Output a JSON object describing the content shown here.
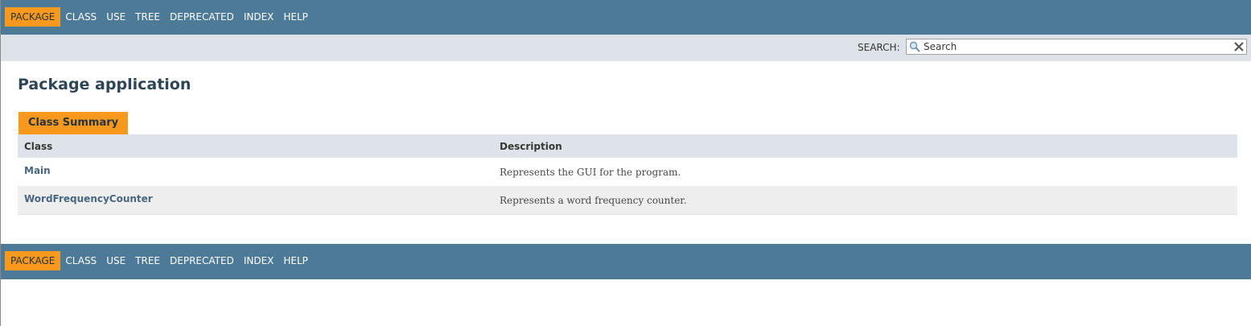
{
  "nav": {
    "items": [
      {
        "label": "PACKAGE",
        "active": true
      },
      {
        "label": "CLASS",
        "active": false
      },
      {
        "label": "USE",
        "active": false
      },
      {
        "label": "TREE",
        "active": false
      },
      {
        "label": "DEPRECATED",
        "active": false
      },
      {
        "label": "INDEX",
        "active": false
      },
      {
        "label": "HELP",
        "active": false
      }
    ]
  },
  "search": {
    "label": "SEARCH:",
    "placeholder": "Search",
    "value": ""
  },
  "page": {
    "title": "Package application"
  },
  "summary": {
    "caption": "Class Summary",
    "headers": {
      "class": "Class",
      "description": "Description"
    },
    "rows": [
      {
        "name": "Main",
        "description": "Represents the GUI for the program."
      },
      {
        "name": "WordFrequencyCounter",
        "description": "Represents a word frequency counter."
      }
    ]
  },
  "colors": {
    "nav_bg": "#4d7a97",
    "active_tab": "#f8981d",
    "subnav_bg": "#dee3e9",
    "link": "#4a6782"
  },
  "icons": {
    "search": "search-icon",
    "reset": "close-icon"
  }
}
